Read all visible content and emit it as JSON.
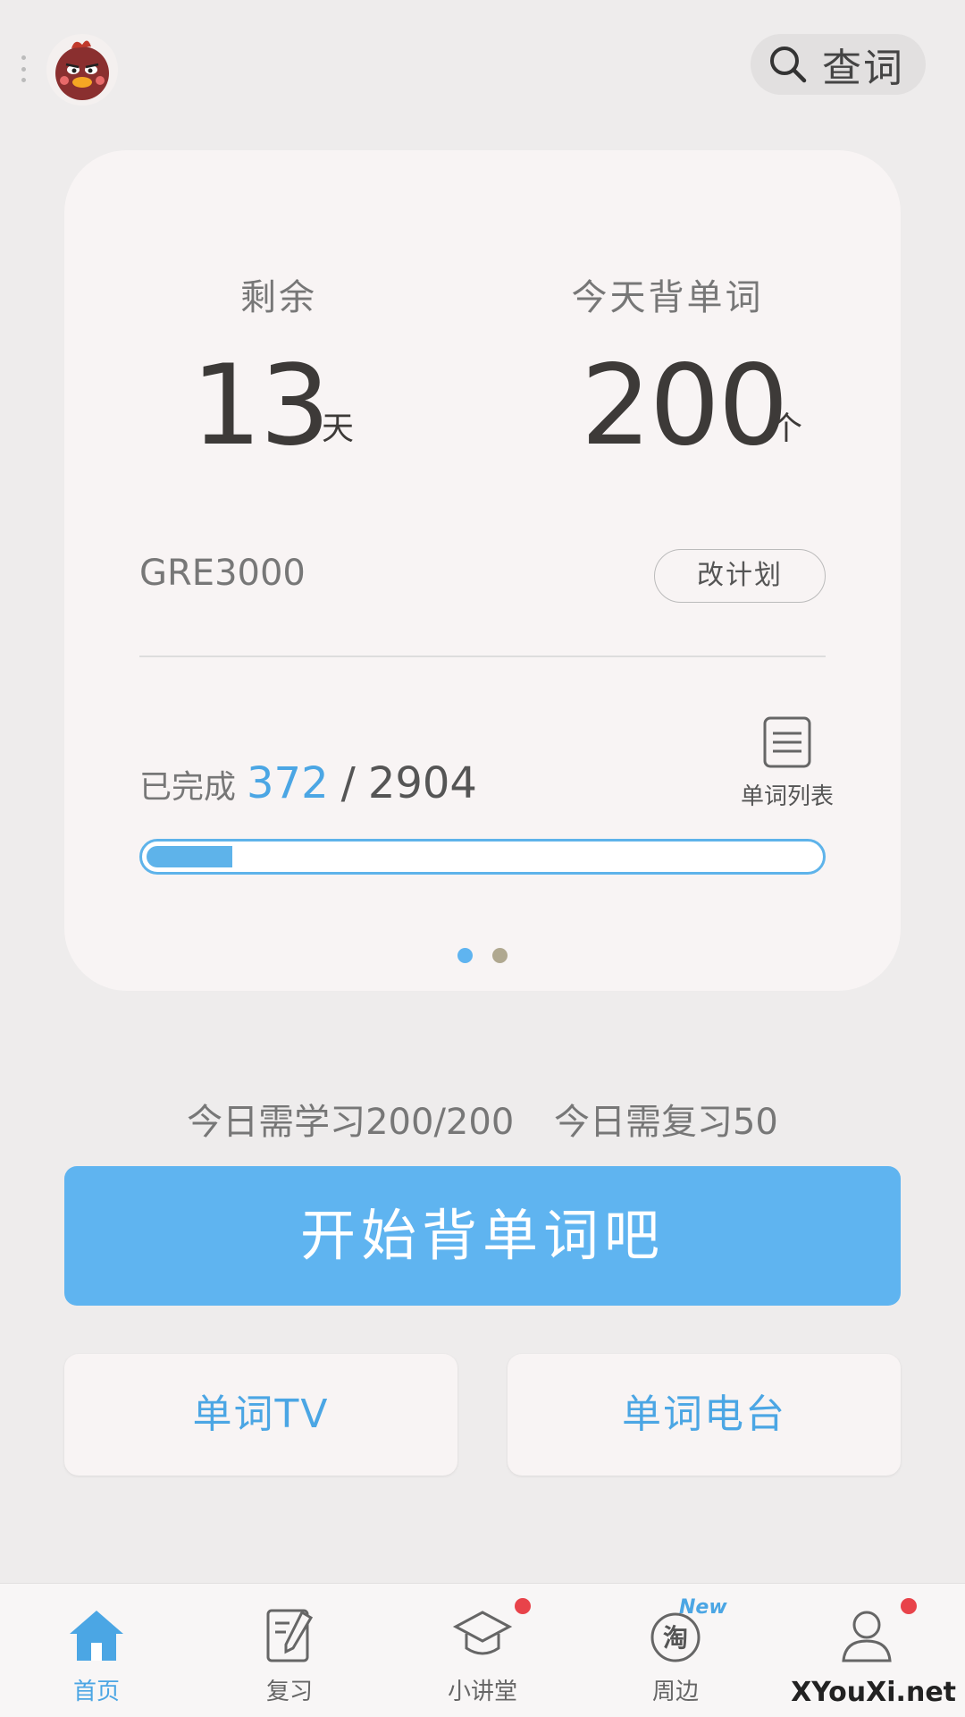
{
  "header": {
    "search_label": "查词"
  },
  "card": {
    "remaining_label": "剩余",
    "remaining_value": "13",
    "remaining_unit": "天",
    "today_label": "今天背单词",
    "today_value": "200",
    "today_unit": "个",
    "book_name": "GRE3000",
    "change_plan_label": "改计划",
    "completed_label": "已完成",
    "completed_value": "372",
    "separator": "/",
    "total_value": "2904",
    "progress_fraction": 0.128,
    "word_list_label": "单词列表",
    "pager": {
      "count": 2,
      "active_index": 0
    }
  },
  "daily": {
    "learn_text": "今日需学习200/200",
    "review_text": "今日需复习50"
  },
  "start_button_label": "开始背单词吧",
  "features": {
    "tv_label": "单词TV",
    "radio_label": "单词电台"
  },
  "tabs": [
    {
      "label": "首页",
      "icon": "home-icon",
      "active": true
    },
    {
      "label": "复习",
      "icon": "review-icon",
      "active": false
    },
    {
      "label": "小讲堂",
      "icon": "graduation-cap-icon",
      "active": false,
      "red_dot": true
    },
    {
      "label": "周边",
      "icon": "taobao-icon",
      "active": false,
      "badge": "New"
    },
    {
      "label": "",
      "icon": "user-icon",
      "active": false,
      "red_dot": true
    }
  ],
  "watermark": "XYouXi.net",
  "colors": {
    "accent": "#5fb4f0",
    "accent_text": "#4ba6e4",
    "background": "#eeecec",
    "card": "#f8f4f4",
    "pager_inactive": "#b0a890",
    "red_dot": "#e8434a"
  }
}
